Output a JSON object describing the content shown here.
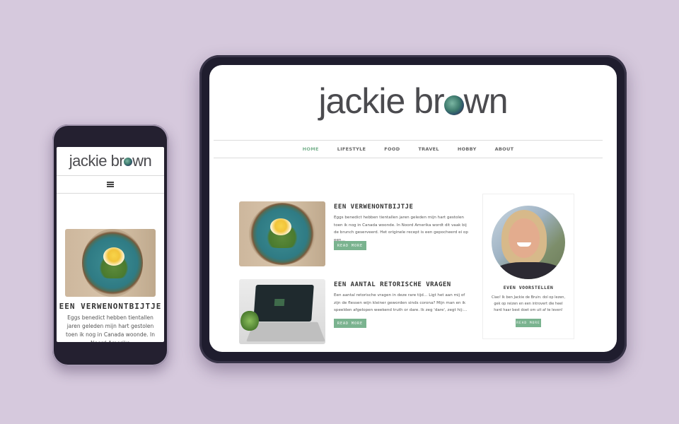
{
  "phone": {
    "logo_prefix": "jackie br",
    "logo_suffix": "wn",
    "menu_icon": "hamburger-icon",
    "post": {
      "title": "EEN VERWENONTBIJTJE",
      "excerpt": "Eggs benedict hebben tientallen jaren geleden mijn hart gestolen toen ik nog in Canada woonde. In Noord Amerika"
    }
  },
  "tablet": {
    "logo_prefix": "jackie br",
    "logo_suffix": "wn",
    "nav": {
      "items": [
        "HOME",
        "LIFESTYLE",
        "FOOD",
        "TRAVEL",
        "HOBBY",
        "ABOUT"
      ],
      "active": "HOME"
    },
    "posts": [
      {
        "title": "EEN VERWENONTBIJTJE",
        "excerpt": "Eggs benedict hebben tientallen jaren geleden mijn hart gestolen toen ik nog in Canada woonde. In Noord Amerika wordt dit vaak bij de brunch geserveerd. Het originele recept is een gepocheerd ei op een…",
        "button": "READ MORE"
      },
      {
        "title": "EEN AANTAL RETORISCHE VRAGEN",
        "excerpt": "Een aantal retorische vragen in deze rare tijd… Ligt het aan mij of zijn de flessen wijn kleiner geworden sinds corona? Mijn man en ik speelden afgelopen weekend truth or dare. Ik zeg 'dare', zegt hij:…",
        "button": "READ MORE"
      }
    ],
    "sidebar": {
      "title": "EVEN VOORSTELLEN",
      "text": "Ciao! Ik ben Jackie de Bruin: dol op lezen, gek op reizen en een introvert die heel hard haar best doet om uit af te leven!",
      "button": "READ MORE"
    }
  },
  "colors": {
    "background": "#d6c9dd",
    "accent": "#7ab38f",
    "device_frame": "#1f1d2e",
    "logo_text": "#4b4b4f"
  }
}
